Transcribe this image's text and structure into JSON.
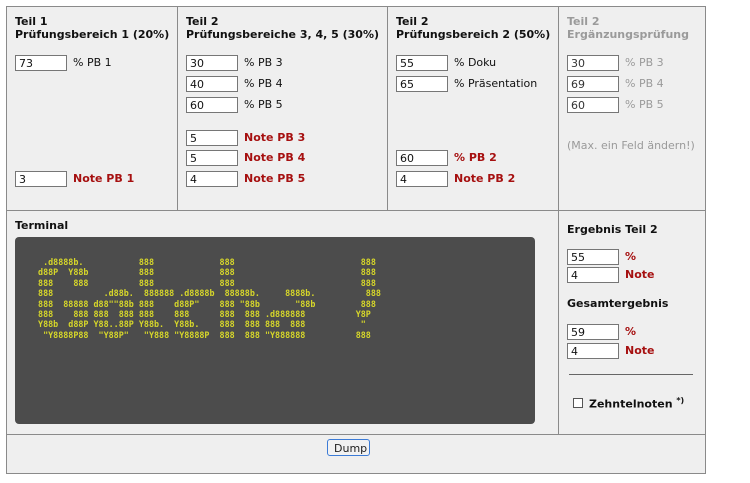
{
  "col1": {
    "title": "Teil 1",
    "subtitle": "Prüfungsbereich 1 (20%)",
    "pb1_pct": "73",
    "pb1_pct_label": "% PB 1",
    "note_value": "3",
    "note_label": "Note PB 1"
  },
  "col2": {
    "title": "Teil 2",
    "subtitle": "Prüfungsbereiche 3, 4, 5 (30%)",
    "pct": [
      {
        "value": "30",
        "label": "% PB 3"
      },
      {
        "value": "40",
        "label": "% PB 4"
      },
      {
        "value": "60",
        "label": "% PB 5"
      }
    ],
    "notes": [
      {
        "value": "5",
        "label": "Note PB 3"
      },
      {
        "value": "5",
        "label": "Note PB 4"
      },
      {
        "value": "4",
        "label": "Note PB 5"
      }
    ]
  },
  "col3": {
    "title": "Teil 2",
    "subtitle": "Prüfungsbereich 2 (50%)",
    "doku_value": "55",
    "doku_label": "% Doku",
    "praes_value": "65",
    "praes_label": "% Präsentation",
    "pb2_pct_value": "60",
    "pb2_pct_label": "% PB 2",
    "pb2_note_value": "4",
    "pb2_note_label": "Note PB 2"
  },
  "col4": {
    "title": "Teil 2",
    "subtitle": "Ergänzungsprüfung",
    "pct": [
      {
        "value": "30",
        "label": "% PB 3"
      },
      {
        "value": "69",
        "label": "% PB 4"
      },
      {
        "value": "60",
        "label": "% PB 5"
      }
    ],
    "hint": "(Max. ein Feld ändern!)"
  },
  "terminal": {
    "title": "Terminal",
    "text": "  .d8888b.           888             888                         888\n d88P  Y88b          888             888                         888\n 888    888          888             888                         888\n 888          .d88b.  888888 .d8888b  88888b.     8888b.          888\n 888  88888 d88\"\"88b 888    d88P\"    888 \"88b       \"88b         888\n 888    888 888  888 888    888      888  888 .d888888          Y8P\n Y88b  d88P Y88..88P Y88b.  Y88b.    888  888 888  888           \"\n  \"Y8888P88  \"Y88P\"   \"Y888 \"Y8888P  888  888 \"Y888888          888"
  },
  "result": {
    "teil2_title": "Ergebnis Teil 2",
    "teil2_pct_value": "55",
    "teil2_pct_label": "%",
    "teil2_note_value": "4",
    "teil2_note_label": "Note",
    "gesamt_title": "Gesamtergebnis",
    "gesamt_pct_value": "59",
    "gesamt_pct_label": "%",
    "gesamt_note_value": "4",
    "gesamt_note_label": "Note",
    "checkbox_label": "Zehntelnoten",
    "checkbox_sup": "*)",
    "checkbox_checked": false
  },
  "footer": {
    "dump_label": "Dump"
  }
}
